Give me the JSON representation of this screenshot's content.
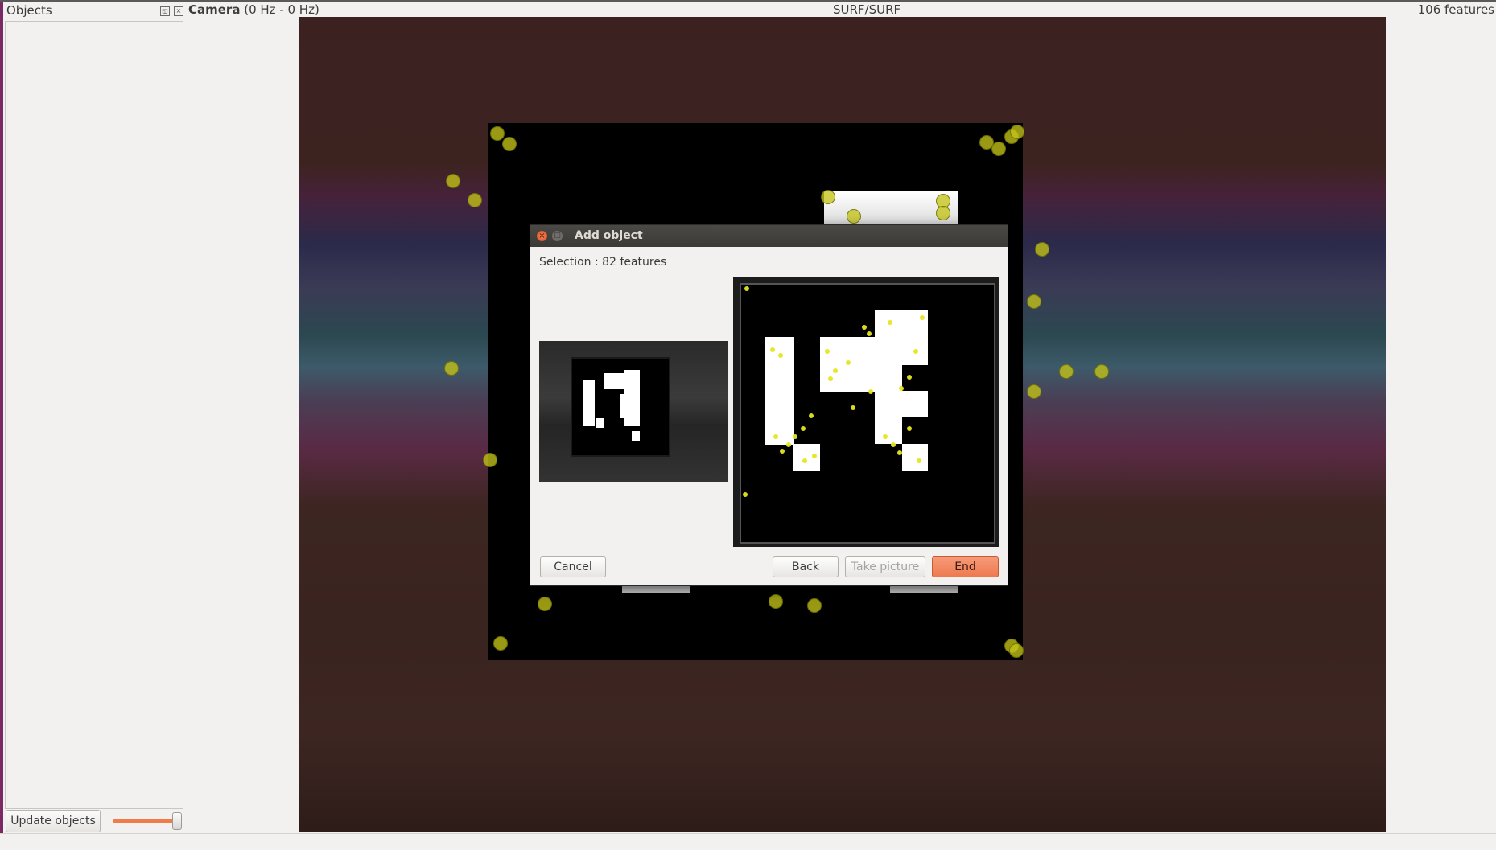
{
  "dock": {
    "title": "Objects",
    "float_icon": "float-icon",
    "close_icon": "close-icon",
    "update_button": "Update objects"
  },
  "camera": {
    "title_bold": "Camera",
    "title_rest": " (0 Hz - 0 Hz)",
    "detector": "SURF/SURF",
    "features": "106 features"
  },
  "dialog": {
    "title": "Add object",
    "selection": "Selection : 82 features",
    "buttons": {
      "cancel": "Cancel",
      "back": "Back",
      "take_picture": "Take picture",
      "end": "End"
    }
  },
  "colors": {
    "accent": "#ee7a50",
    "keypoint": "#c4c418",
    "dock_border": "#7a2a63"
  }
}
